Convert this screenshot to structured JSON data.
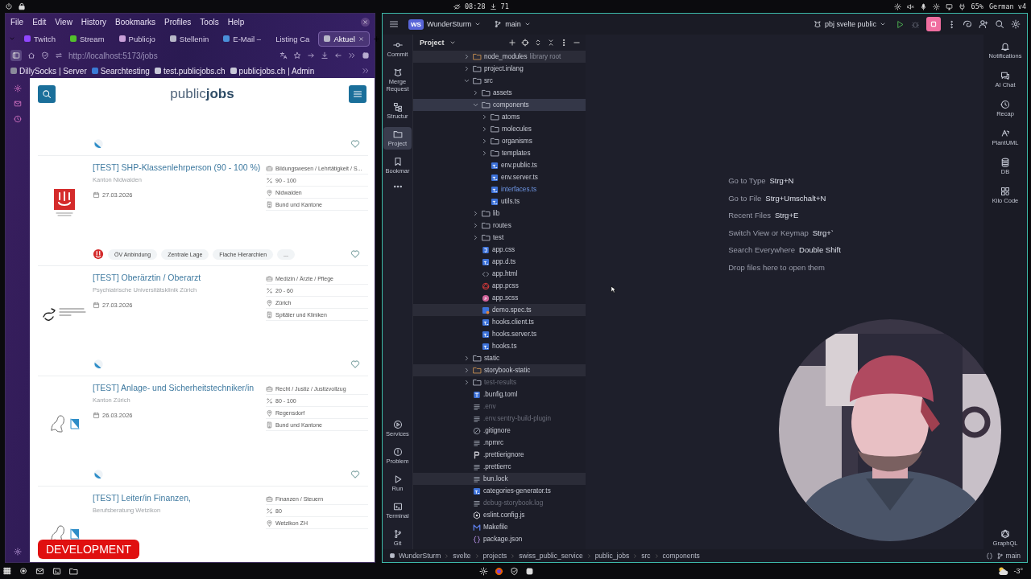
{
  "system_bar": {
    "clock": "08:28",
    "downloads": "71",
    "battery": "65%",
    "keyboard_layout": "German v4"
  },
  "browser": {
    "menu": [
      "File",
      "Edit",
      "View",
      "History",
      "Bookmarks",
      "Profiles",
      "Tools",
      "Help"
    ],
    "tabs": [
      {
        "label": "Twitch",
        "selected": false,
        "color": "#9146ff"
      },
      {
        "label": "Stream",
        "selected": false,
        "color": "#53c02c"
      },
      {
        "label": "Publicjo",
        "selected": false,
        "color": "#c9a0d8"
      },
      {
        "label": "Stellenin",
        "selected": false,
        "color": "#b8b8c8"
      },
      {
        "label": "E-Mail –",
        "selected": false,
        "color": "#4a90d9"
      },
      {
        "label": "Listing Ca",
        "selected": false
      },
      {
        "label": "Aktuel",
        "selected": true,
        "color": "#b8b8c8"
      }
    ],
    "url": "http://localhost:5173/jobs",
    "bookmarks": [
      {
        "label": "DillySocks | Server",
        "color": "#8a8a9a"
      },
      {
        "label": "Searchtesting",
        "color": "#3a7bd5"
      },
      {
        "label": "test.publicjobs.ch",
        "color": "#c8c8d8"
      },
      {
        "label": "publicjobs.ch | Admin",
        "color": "#c8c8d8"
      }
    ],
    "page": {
      "logo": {
        "light": "public",
        "bold": "jobs"
      },
      "cards": [
        {
          "kind": "zurich"
        },
        {
          "kind": "nidwalden",
          "title": "[TEST] SHP-Klassenlehrperson (90 - 100 %)",
          "employer": "Kanton Nidwalden",
          "date": "27.03.2026",
          "details": [
            {
              "kind": "category",
              "text": "Bildungswesen / Lehrtätigkeit / S..."
            },
            {
              "kind": "workload",
              "text": "90 - 100"
            },
            {
              "kind": "location",
              "text": "Nidwalden"
            },
            {
              "kind": "sector",
              "text": "Bund und Kantone"
            }
          ],
          "tags": [
            "ÖV Anbindung",
            "Zentrale Lage",
            "Flache Hierarchien",
            "..."
          ]
        },
        {
          "kind": "puk",
          "title": "[TEST] Oberärztin / Oberarzt",
          "employer": "Psychiatrische Universitätsklinik Zürich",
          "date": "27.03.2026",
          "details": [
            {
              "kind": "category",
              "text": "Medizin / Ärzte / Pflege"
            },
            {
              "kind": "workload",
              "text": "20 - 60"
            },
            {
              "kind": "location",
              "text": "Zürich"
            },
            {
              "kind": "sector",
              "text": "Spitäler und Kliniken"
            }
          ]
        },
        {
          "kind": "zurich",
          "title": "[TEST] Anlage- und Sicherheitstechniker/in",
          "employer": "Kanton Zürich",
          "date": "26.03.2026",
          "details": [
            {
              "kind": "category",
              "text": "Recht / Justiz / Justizvollzug"
            },
            {
              "kind": "workload",
              "text": "80 - 100"
            },
            {
              "kind": "location",
              "text": "Regensdorf"
            },
            {
              "kind": "sector",
              "text": "Bund und Kantone"
            }
          ]
        },
        {
          "kind": "zurich",
          "title": "[TEST] Leiter/in Finanzen,",
          "employer": "Berufsberatung Wetzikon",
          "details": [
            {
              "kind": "category",
              "text": "Finanzen / Steuern"
            },
            {
              "kind": "workload",
              "text": "80"
            },
            {
              "kind": "location",
              "text": "Wetzikon ZH"
            }
          ]
        }
      ],
      "badge": "DEVELOPMENT"
    }
  },
  "ide": {
    "avatar": "WS",
    "project": "WunderSturm",
    "branch": "main",
    "run_config": "pbj svelte public",
    "left_tools": [
      {
        "label": "Commit",
        "selected": false
      },
      {
        "label": "Merge Request",
        "selected": false
      },
      {
        "label": "Structur",
        "selected": false
      },
      {
        "label": "Project",
        "selected": true
      },
      {
        "label": "Bookmar",
        "selected": false
      }
    ],
    "bottom_tools": [
      {
        "label": "Services"
      },
      {
        "label": "Problem"
      },
      {
        "label": "Run"
      },
      {
        "label": "Terminal"
      },
      {
        "label": "Git"
      }
    ],
    "right_tools": [
      {
        "label": "Notifications"
      },
      {
        "label": "AI Chat"
      },
      {
        "label": "Recap"
      },
      {
        "label": "PlantUML"
      },
      {
        "label": "DB"
      },
      {
        "label": "Kilo Code"
      }
    ],
    "right_bottom_tools": [
      {
        "label": "GraphQL"
      }
    ],
    "panel_title": "Project",
    "tree": [
      {
        "name": "node_modules",
        "note": "library root",
        "kind": "folder-excluded",
        "expanded": false,
        "selected": false,
        "highlighted": true,
        "ignored": false,
        "modified": false
      },
      {
        "name": "project.inlang",
        "kind": "folder",
        "expanded": false,
        "selected": false,
        "highlighted": false,
        "ignored": false,
        "modified": false
      },
      {
        "name": "src",
        "kind": "folder",
        "expanded": true,
        "selected": false,
        "highlighted": false,
        "ignored": false,
        "modified": false,
        "children": [
          {
            "name": "assets",
            "kind": "folder",
            "expanded": false,
            "selected": false,
            "highlighted": false,
            "ignored": false,
            "modified": false
          },
          {
            "name": "components",
            "kind": "folder",
            "expanded": true,
            "selected": true,
            "highlighted": false,
            "ignored": false,
            "modified": false,
            "children": [
              {
                "name": "atoms",
                "kind": "folder",
                "expanded": false,
                "selected": false,
                "highlighted": false,
                "ignored": false,
                "modified": false
              },
              {
                "name": "molecules",
                "kind": "folder",
                "expanded": false,
                "selected": false,
                "highlighted": false,
                "ignored": false,
                "modified": false
              },
              {
                "name": "organisms",
                "kind": "folder",
                "expanded": false,
                "selected": false,
                "highlighted": false,
                "ignored": false,
                "modified": false
              },
              {
                "name": "templates",
                "kind": "folder",
                "expanded": false,
                "selected": false,
                "highlighted": false,
                "ignored": false,
                "modified": false
              },
              {
                "name": "env.public.ts",
                "kind": "ts",
                "selected": false,
                "highlighted": false,
                "ignored": false,
                "modified": false
              },
              {
                "name": "env.server.ts",
                "kind": "ts",
                "selected": false,
                "highlighted": false,
                "ignored": false,
                "modified": false
              },
              {
                "name": "interfaces.ts",
                "kind": "ts",
                "selected": false,
                "highlighted": false,
                "ignored": false,
                "modified": true
              },
              {
                "name": "utils.ts",
                "kind": "ts",
                "selected": false,
                "highlighted": false,
                "ignored": false,
                "modified": false
              }
            ]
          },
          {
            "name": "lib",
            "kind": "folder",
            "expanded": false,
            "selected": false,
            "highlighted": false,
            "ignored": false,
            "modified": false
          },
          {
            "name": "routes",
            "kind": "folder",
            "expanded": false,
            "selected": false,
            "highlighted": false,
            "ignored": false,
            "modified": false
          },
          {
            "name": "test",
            "kind": "folder",
            "expanded": false,
            "selected": false,
            "highlighted": false,
            "ignored": false,
            "modified": false
          },
          {
            "name": "app.css",
            "kind": "css",
            "selected": false,
            "highlighted": false,
            "ignored": false,
            "modified": false
          },
          {
            "name": "app.d.ts",
            "kind": "ts",
            "selected": false,
            "highlighted": false,
            "ignored": false,
            "modified": false
          },
          {
            "name": "app.html",
            "kind": "html",
            "selected": false,
            "highlighted": false,
            "ignored": false,
            "modified": false
          },
          {
            "name": "app.pcss",
            "kind": "pcss",
            "selected": false,
            "highlighted": false,
            "ignored": false,
            "modified": false
          },
          {
            "name": "app.scss",
            "kind": "scss",
            "selected": false,
            "highlighted": false,
            "ignored": false,
            "modified": false
          },
          {
            "name": "demo.spec.ts",
            "kind": "spec",
            "selected": false,
            "highlighted": true,
            "ignored": false,
            "modified": false
          },
          {
            "name": "hooks.client.ts",
            "kind": "ts",
            "selected": false,
            "highlighted": false,
            "ignored": false,
            "modified": false
          },
          {
            "name": "hooks.server.ts",
            "kind": "ts",
            "selected": false,
            "highlighted": false,
            "ignored": false,
            "modified": false
          },
          {
            "name": "hooks.ts",
            "kind": "ts",
            "selected": false,
            "highlighted": false,
            "ignored": false,
            "modified": false
          }
        ]
      },
      {
        "name": "static",
        "kind": "folder",
        "expanded": false,
        "selected": false,
        "highlighted": false,
        "ignored": false,
        "modified": false
      },
      {
        "name": "storybook-static",
        "kind": "folder-excluded",
        "expanded": false,
        "selected": false,
        "highlighted": true,
        "ignored": false,
        "modified": false
      },
      {
        "name": "test-results",
        "kind": "folder",
        "expanded": false,
        "selected": false,
        "highlighted": false,
        "ignored": true,
        "modified": false
      },
      {
        "name": ".bunfig.toml",
        "kind": "toml",
        "selected": false,
        "highlighted": false,
        "ignored": false,
        "modified": false
      },
      {
        "name": ".env",
        "kind": "text",
        "selected": false,
        "highlighted": false,
        "ignored": true,
        "modified": false
      },
      {
        "name": ".env.sentry-build-plugin",
        "kind": "text",
        "selected": false,
        "highlighted": false,
        "ignored": true,
        "modified": false
      },
      {
        "name": ".gitignore",
        "kind": "ignore",
        "selected": false,
        "highlighted": false,
        "ignored": false,
        "modified": false
      },
      {
        "name": ".npmrc",
        "kind": "text",
        "selected": false,
        "highlighted": false,
        "ignored": false,
        "modified": false
      },
      {
        "name": ".prettierignore",
        "kind": "prettier",
        "selected": false,
        "highlighted": false,
        "ignored": false,
        "modified": false
      },
      {
        "name": ".prettierrc",
        "kind": "text",
        "selected": false,
        "highlighted": false,
        "ignored": false,
        "modified": false
      },
      {
        "name": "bun.lock",
        "kind": "text",
        "selected": false,
        "highlighted": true,
        "ignored": false,
        "modified": false
      },
      {
        "name": "categories-generator.ts",
        "kind": "ts",
        "selected": false,
        "highlighted": false,
        "ignored": false,
        "modified": false
      },
      {
        "name": "debug-storybook.log",
        "kind": "text",
        "selected": false,
        "highlighted": false,
        "ignored": true,
        "modified": false
      },
      {
        "name": "eslint.config.js",
        "kind": "eslint",
        "selected": false,
        "highlighted": false,
        "ignored": false,
        "modified": false
      },
      {
        "name": "Makefile",
        "kind": "makefile",
        "selected": false,
        "highlighted": false,
        "ignored": false,
        "modified": false
      },
      {
        "name": "package.json",
        "kind": "json",
        "selected": false,
        "highlighted": false,
        "ignored": false,
        "modified": false
      }
    ],
    "hints": [
      {
        "action": "Go to Type",
        "shortcut": "Strg+N"
      },
      {
        "action": "Go to File",
        "shortcut": "Strg+Umschalt+N"
      },
      {
        "action": "Recent Files",
        "shortcut": "Strg+E"
      },
      {
        "action": "Switch View or Keymap",
        "shortcut": "Strg+`"
      },
      {
        "action": "Search Everywhere",
        "shortcut": "Double Shift"
      },
      {
        "action": "Drop files here to open them"
      }
    ],
    "webcam": {
      "kind": "picture"
    },
    "breadcrumb": [
      "WunderSturm",
      "svelte",
      "projects",
      "swiss_public_service",
      "public_jobs",
      "src",
      "components"
    ],
    "status_branch": "main"
  },
  "taskbar": {
    "temperature": "-3°"
  }
}
